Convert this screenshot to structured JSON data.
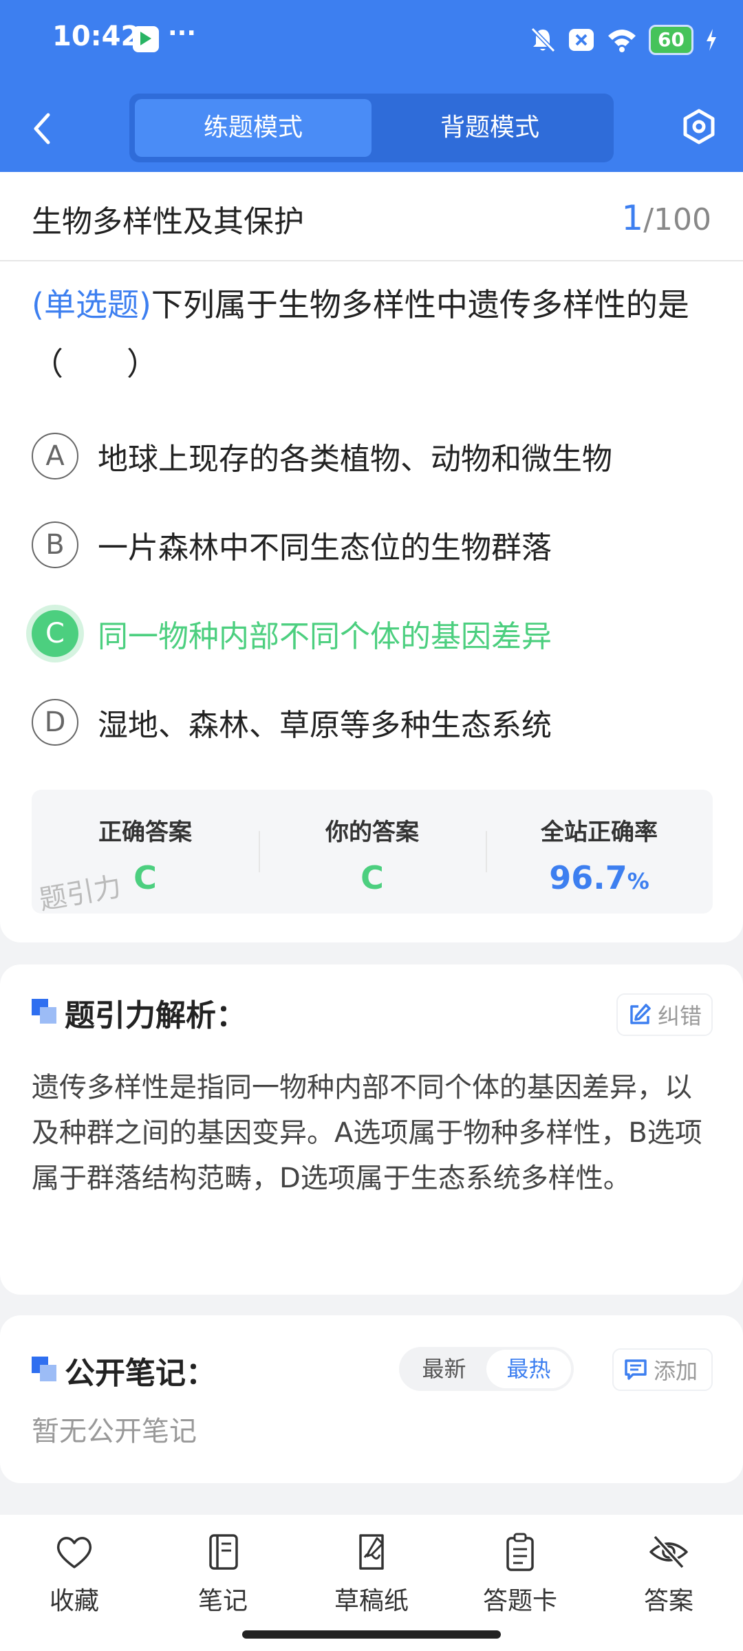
{
  "status_bar": {
    "time": "10:42",
    "more": "···",
    "battery": "60",
    "icons": [
      "app-icon",
      "bell-off-icon",
      "close-box-icon",
      "wifi-icon",
      "battery-icon",
      "charging-icon"
    ]
  },
  "header": {
    "tabs": [
      {
        "label": "练题模式",
        "active": true
      },
      {
        "label": "背题模式",
        "active": false
      }
    ],
    "accent": "#3d7ff0"
  },
  "chapter": {
    "title": "生物多样性及其保护",
    "current": "1",
    "total": "/100"
  },
  "question": {
    "type": "(单选题)",
    "text": "下列属于生物多样性中遗传多样性的是（　　）",
    "options": [
      {
        "letter": "A",
        "text": "地球上现存的各类植物、动物和微生物"
      },
      {
        "letter": "B",
        "text": "一片森林中不同生态位的生物群落"
      },
      {
        "letter": "C",
        "text": "同一物种内部不同个体的基因差异",
        "correct": true
      },
      {
        "letter": "D",
        "text": "湿地、森林、草原等多种生态系统"
      }
    ]
  },
  "result": {
    "correct_label": "正确答案",
    "correct_value": "C",
    "yours_label": "你的答案",
    "yours_value": "C",
    "rate_label": "全站正确率",
    "rate_value": "96.7",
    "rate_unit": "%",
    "watermark": "题引力"
  },
  "analysis": {
    "title": "题引力解析：",
    "report_label": "纠错",
    "text": "遗传多样性是指同一物种内部不同个体的基因差异，以及种群之间的基因变异。A选项属于物种多样性，B选项属于群落结构范畴，D选项属于生态系统多样性。"
  },
  "notes": {
    "title": "公开笔记：",
    "sort_tabs": [
      {
        "label": "最新",
        "active": false
      },
      {
        "label": "最热",
        "active": true
      }
    ],
    "add_label": "添加",
    "empty": "暂无公开笔记"
  },
  "bottom_nav": [
    {
      "label": "收藏",
      "icon": "heart-icon"
    },
    {
      "label": "笔记",
      "icon": "notebook-icon"
    },
    {
      "label": "草稿纸",
      "icon": "draft-paper-icon"
    },
    {
      "label": "答题卡",
      "icon": "answer-card-icon"
    },
    {
      "label": "答案",
      "icon": "eye-off-icon"
    }
  ],
  "colors": {
    "correct": "#4ccf7f",
    "muted": "#999999"
  }
}
